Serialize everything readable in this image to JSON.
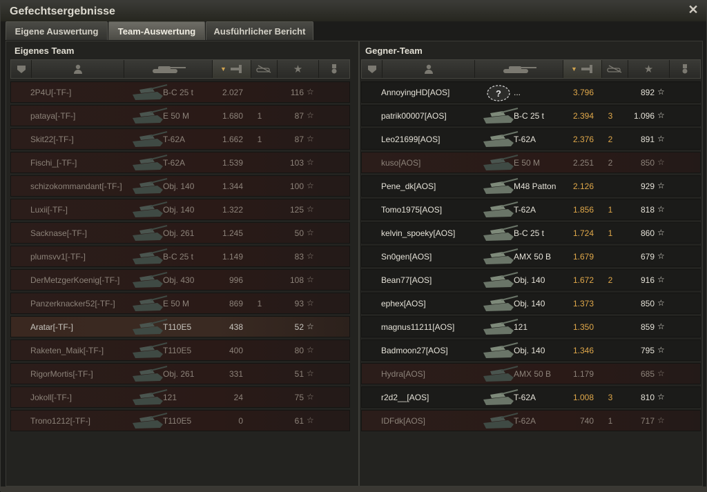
{
  "window": {
    "title": "Gefechtsergebnisse",
    "close_icon": "close-icon"
  },
  "tabs": [
    {
      "label": "Eigene Auswertung",
      "active": false
    },
    {
      "label": "Team-Auswertung",
      "active": true
    },
    {
      "label": "Ausführlicher Bericht",
      "active": false
    }
  ],
  "colors": {
    "accent_orange": "#e0a84a",
    "dead_row": "#2b1d1a",
    "alive_text": "#e5e2d8"
  },
  "own_team": {
    "title": "Eigenes Team",
    "rows": [
      {
        "name": "2P4U[-TF-]",
        "tank": "B-C 25 t",
        "damage": "2.027",
        "kills": "",
        "xp": "116",
        "status": "dead"
      },
      {
        "name": "pataya[-TF-]",
        "tank": "E 50 M",
        "damage": "1.680",
        "kills": "1",
        "xp": "87",
        "status": "dead"
      },
      {
        "name": "Skit22[-TF-]",
        "tank": "T-62A",
        "damage": "1.662",
        "kills": "1",
        "xp": "87",
        "status": "dead"
      },
      {
        "name": "Fischi_[-TF-]",
        "tank": "T-62A",
        "damage": "1.539",
        "kills": "",
        "xp": "103",
        "status": "dead"
      },
      {
        "name": "schizokommandant[-TF-]",
        "tank": "Obj. 140",
        "damage": "1.344",
        "kills": "",
        "xp": "100",
        "status": "dead"
      },
      {
        "name": "Luxii[-TF-]",
        "tank": "Obj. 140",
        "damage": "1.322",
        "kills": "",
        "xp": "125",
        "status": "dead"
      },
      {
        "name": "Sacknase[-TF-]",
        "tank": "Obj. 261",
        "damage": "1.245",
        "kills": "",
        "xp": "50",
        "status": "dead"
      },
      {
        "name": "plumsvv1[-TF-]",
        "tank": "B-C 25 t",
        "damage": "1.149",
        "kills": "",
        "xp": "83",
        "status": "dead"
      },
      {
        "name": "DerMetzgerKoenig[-TF-]",
        "tank": "Obj. 430",
        "damage": "996",
        "kills": "",
        "xp": "108",
        "status": "dead"
      },
      {
        "name": "Panzerknacker52[-TF-]",
        "tank": "E 50 M",
        "damage": "869",
        "kills": "1",
        "xp": "93",
        "status": "dead"
      },
      {
        "name": "Aratar[-TF-]",
        "tank": "T110E5",
        "damage": "438",
        "kills": "",
        "xp": "52",
        "status": "me"
      },
      {
        "name": "Raketen_Maik[-TF-]",
        "tank": "T110E5",
        "damage": "400",
        "kills": "",
        "xp": "80",
        "status": "dead"
      },
      {
        "name": "RigorMortis[-TF-]",
        "tank": "Obj. 261",
        "damage": "331",
        "kills": "",
        "xp": "51",
        "status": "dead"
      },
      {
        "name": "Jokoll[-TF-]",
        "tank": "121",
        "damage": "24",
        "kills": "",
        "xp": "75",
        "status": "dead"
      },
      {
        "name": "Trono1212[-TF-]",
        "tank": "T110E5",
        "damage": "0",
        "kills": "",
        "xp": "61",
        "status": "dead"
      }
    ]
  },
  "enemy_team": {
    "title": "Gegner-Team",
    "rows": [
      {
        "name": "AnnoyingHD[AOS]",
        "tank": "...",
        "damage": "3.796",
        "kills": "",
        "xp": "892",
        "status": "alive",
        "unknown": true
      },
      {
        "name": "patrik00007[AOS]",
        "tank": "B-C 25 t",
        "damage": "2.394",
        "kills": "3",
        "xp": "1.096",
        "status": "alive"
      },
      {
        "name": "Leo21699[AOS]",
        "tank": "T-62A",
        "damage": "2.376",
        "kills": "2",
        "xp": "891",
        "status": "alive"
      },
      {
        "name": "kuso[AOS]",
        "tank": "E 50 M",
        "damage": "2.251",
        "kills": "2",
        "xp": "850",
        "status": "dead"
      },
      {
        "name": "Pene_dk[AOS]",
        "tank": "M48 Patton",
        "damage": "2.126",
        "kills": "",
        "xp": "929",
        "status": "alive"
      },
      {
        "name": "Tomo1975[AOS]",
        "tank": "T-62A",
        "damage": "1.856",
        "kills": "1",
        "xp": "818",
        "status": "alive"
      },
      {
        "name": "kelvin_spoeky[AOS]",
        "tank": "B-C 25 t",
        "damage": "1.724",
        "kills": "1",
        "xp": "860",
        "status": "alive"
      },
      {
        "name": "Sn0gen[AOS]",
        "tank": "AMX 50 B",
        "damage": "1.679",
        "kills": "",
        "xp": "679",
        "status": "alive"
      },
      {
        "name": "Bean77[AOS]",
        "tank": "Obj. 140",
        "damage": "1.672",
        "kills": "2",
        "xp": "916",
        "status": "alive"
      },
      {
        "name": "ephex[AOS]",
        "tank": "Obj. 140",
        "damage": "1.373",
        "kills": "",
        "xp": "850",
        "status": "alive"
      },
      {
        "name": "magnus11211[AOS]",
        "tank": "121",
        "damage": "1.350",
        "kills": "",
        "xp": "859",
        "status": "alive"
      },
      {
        "name": "Badmoon27[AOS]",
        "tank": "Obj. 140",
        "damage": "1.346",
        "kills": "",
        "xp": "795",
        "status": "alive"
      },
      {
        "name": "Hydra[AOS]",
        "tank": "AMX 50 B",
        "damage": "1.179",
        "kills": "",
        "xp": "685",
        "status": "dead"
      },
      {
        "name": "r2d2__[AOS]",
        "tank": "T-62A",
        "damage": "1.008",
        "kills": "3",
        "xp": "810",
        "status": "alive"
      },
      {
        "name": "IDFdk[AOS]",
        "tank": "T-62A",
        "damage": "740",
        "kills": "1",
        "xp": "717",
        "status": "dead"
      }
    ]
  },
  "header_icons": [
    "platoon-icon",
    "player-icon",
    "tank-icon",
    "damage-icon",
    "kills-icon",
    "xp-star-icon",
    "medal-icon"
  ]
}
